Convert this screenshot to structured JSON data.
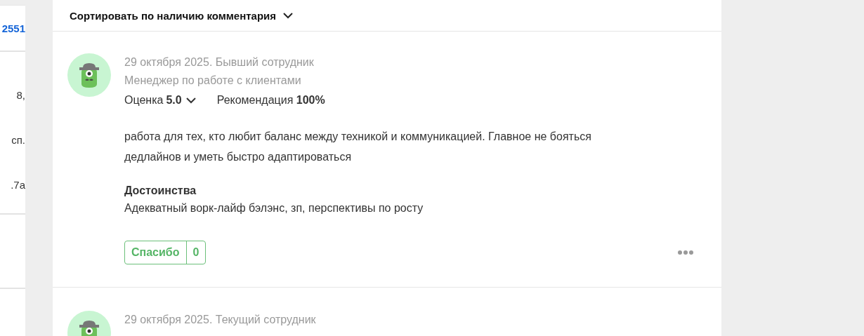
{
  "left_column": {
    "link": "2551",
    "texts": [
      "8,",
      "сп.",
      ".7а"
    ]
  },
  "sort": {
    "label": "Сортировать по наличию комментария"
  },
  "reviews": [
    {
      "date_status": "29 октября 2025. Бывший сотрудник",
      "position": "Менеджер по работе с клиентами",
      "rating_label": "Оценка",
      "rating": "5.0",
      "recommend_label": "Рекомендация",
      "recommend": "100%",
      "text": "работа для тех, кто любит баланс между техникой и коммуникацией. Главное не бояться дедлайнов и уметь быстро адаптироваться",
      "sections": [
        {
          "title": "Достоинства",
          "text": "Адекватный ворк-лайф бэлэнс, зп, перспективы по росту"
        }
      ],
      "thanks_label": "Спасибо",
      "thanks_count": "0"
    },
    {
      "date_status": "29 октября 2025. Текущий сотрудник"
    }
  ]
}
